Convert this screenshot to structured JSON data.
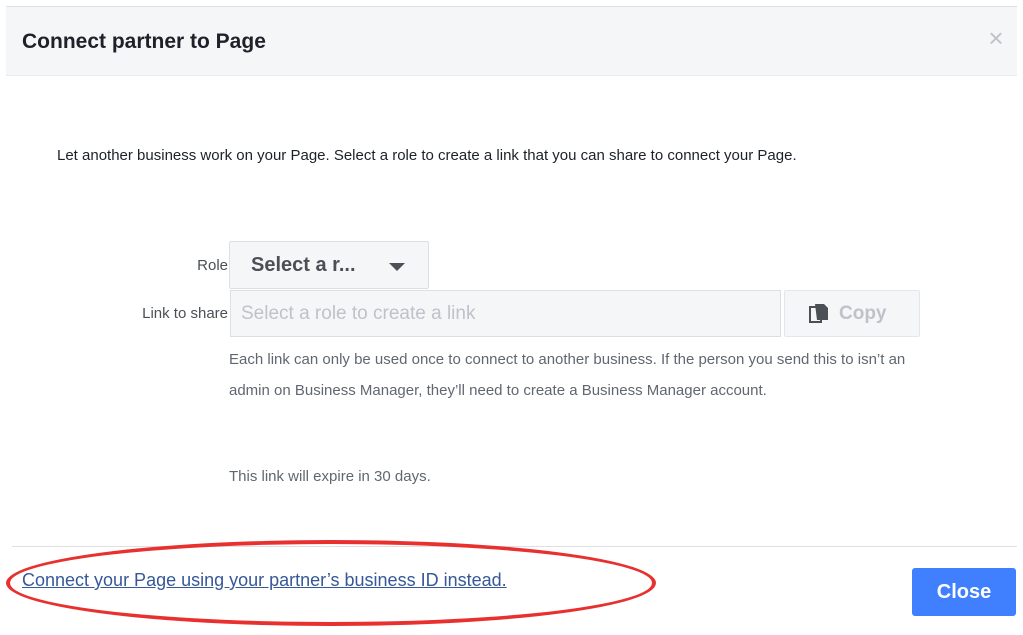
{
  "dialog": {
    "title": "Connect partner to Page",
    "close_icon": "close-icon",
    "intro": "Let another business work on your Page. Select a role to create a link that you can share to connect your Page."
  },
  "form": {
    "role_label": "Role",
    "role_select_value": "Select a r...",
    "link_label": "Link to share",
    "link_placeholder": "Select a role to create a link",
    "copy_label": "Copy",
    "copy_icon": "copy-icon",
    "help_text": "Each link can only be used once to connect to another business. If the person you send this to isn’t an admin on Business Manager, they’ll need to create a Business Manager account.",
    "expire_text": "This link will expire in 30 days."
  },
  "footer": {
    "alt_link": "Connect your Page using your partner’s business ID instead.",
    "close_button": "Close"
  },
  "colors": {
    "primary_button": "#4080ff",
    "link": "#365899",
    "annotation": "#e8312f"
  }
}
